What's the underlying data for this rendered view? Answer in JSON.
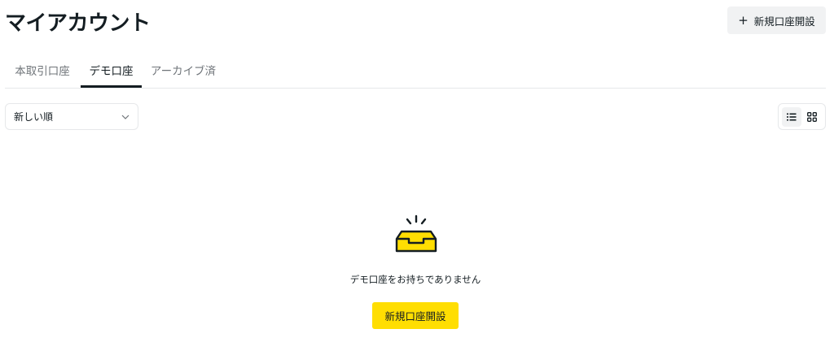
{
  "header": {
    "title": "マイアカウント",
    "add_button_icon": "plus-icon",
    "add_button_label": "新規口座開設"
  },
  "tabs": [
    {
      "label": "本取引口座",
      "active": false
    },
    {
      "label": "デモ口座",
      "active": true
    },
    {
      "label": "アーカイブ済",
      "active": false
    }
  ],
  "toolbar": {
    "sort_selected": "新しい順",
    "view_modes": [
      {
        "icon": "list-view-icon",
        "active": true
      },
      {
        "icon": "grid-view-icon",
        "active": false
      }
    ]
  },
  "empty_state": {
    "icon": "empty-tray-icon",
    "message": "デモ口座をお持ちでありません",
    "button_label": "新規口座開設"
  },
  "colors": {
    "primary_text": "#141d22",
    "muted_text": "#6f7479",
    "accent_yellow": "#ffde02",
    "button_gray": "#f1f2f3",
    "border": "#e6e8ea"
  }
}
